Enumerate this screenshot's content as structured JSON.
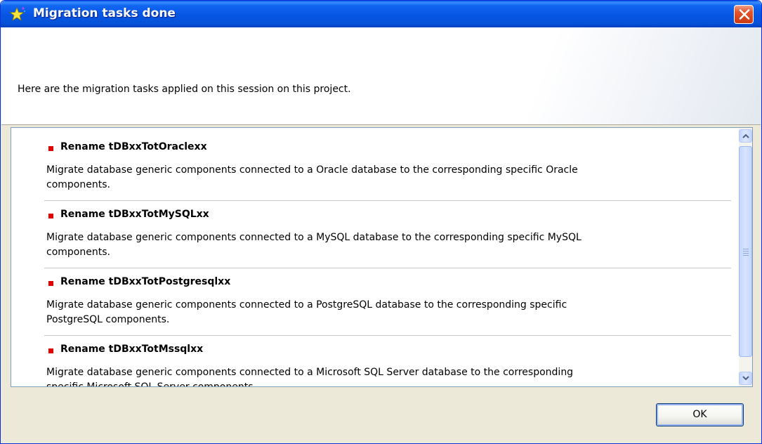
{
  "window": {
    "title": "Migration tasks done",
    "title_icon": "wizard-star-icon",
    "close_icon": "close-icon"
  },
  "header": {
    "message": "Here are the migration tasks applied on this session on this project."
  },
  "tasks": [
    {
      "title": "Rename tDBxxTotOraclexx",
      "line1": "Migrate database generic components connected to a Oracle database to the corresponding specific Oracle",
      "line2": "components."
    },
    {
      "title": "Rename tDBxxTotMySQLxx",
      "line1": "Migrate database generic components connected to a MySQL database to the corresponding specific MySQL",
      "line2": "components."
    },
    {
      "title": "Rename tDBxxTotPostgresqlxx",
      "line1": "Migrate database generic components connected to a PostgreSQL database to the corresponding specific",
      "line2": "PostgreSQL components."
    },
    {
      "title": "Rename tDBxxTotMssqlxx",
      "line1": "Migrate database generic components connected to a Microsoft SQL Server database to the corresponding",
      "line2": "specific Microsoft SQL Server components."
    }
  ],
  "buttons": {
    "ok": "OK"
  },
  "colors": {
    "bullet": "#e00000",
    "titlebar": "#0754e3"
  }
}
